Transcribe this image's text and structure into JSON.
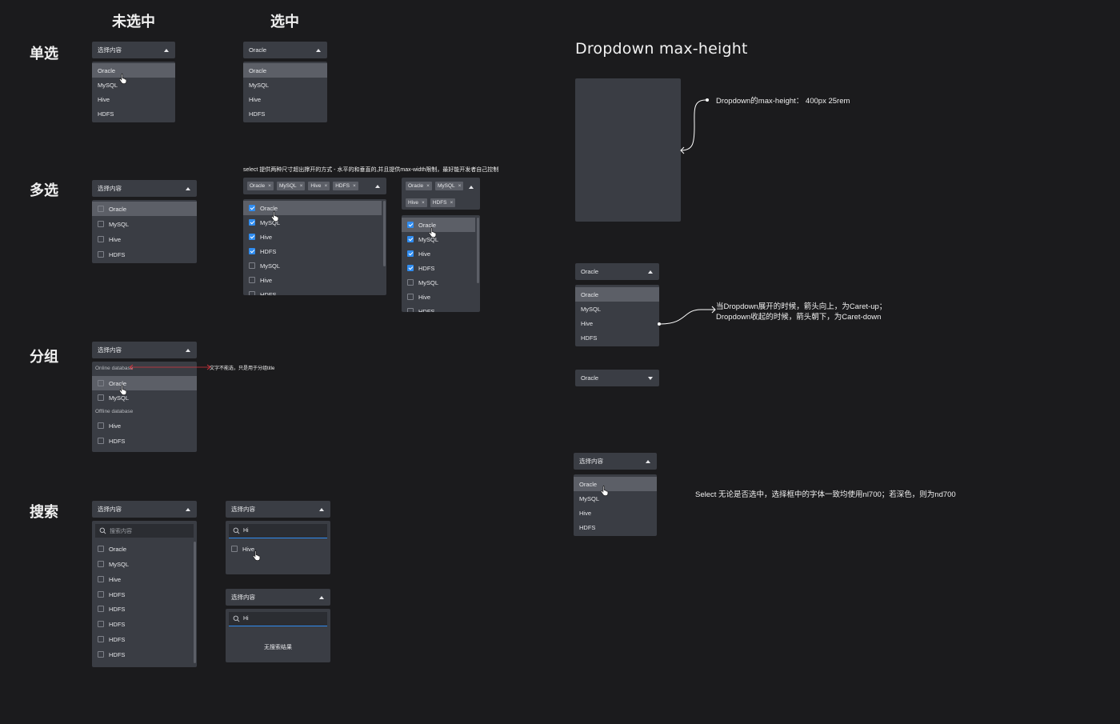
{
  "headers": {
    "unselected": "未选中",
    "selected": "选中"
  },
  "rows": {
    "single": "单选",
    "multi": "多选",
    "group": "分组",
    "search": "搜索"
  },
  "trigger_placeholder": "选择内容",
  "options": {
    "oracle": "Oracle",
    "mysql": "MySQL",
    "hive": "Hive",
    "hdfs": "HDFS"
  },
  "multi": {
    "overflow_note": "select 提供两种尺寸超出撑开的方式 - 水平的和垂直的,并且提供max-width限制，最好能开发者自己控制",
    "tags": [
      "Oracle",
      "MySQL",
      "Hive",
      "HDFS"
    ],
    "tag_close": "×"
  },
  "group": {
    "online_title": "Online database",
    "offline_title": "Offline database",
    "note": "文字不能选，只是用于分组title"
  },
  "search": {
    "placeholder": "搜索内容",
    "query": "Hi",
    "no_result": "无搜索结果"
  },
  "dropdown": {
    "title": "Dropdown max-height",
    "maxheight_note": "Dropdown的max-height：  400px  25rem",
    "caret_note_line1": "当Dropdown展开的时候，箭头向上，为Caret-up；",
    "caret_note_line2": "Dropdown收起的时候，箭头朝下，为Caret-down",
    "font_note": "Select 无论是否选中，选择框中的字体一致均使用nl700；若深色，则为nd700"
  },
  "colors": {
    "background": "#1b1b1d",
    "panel": "#3a3d44",
    "highlight": "#5c5f67",
    "accent": "#2f8cf0",
    "annotation_red": "#d9363e"
  }
}
